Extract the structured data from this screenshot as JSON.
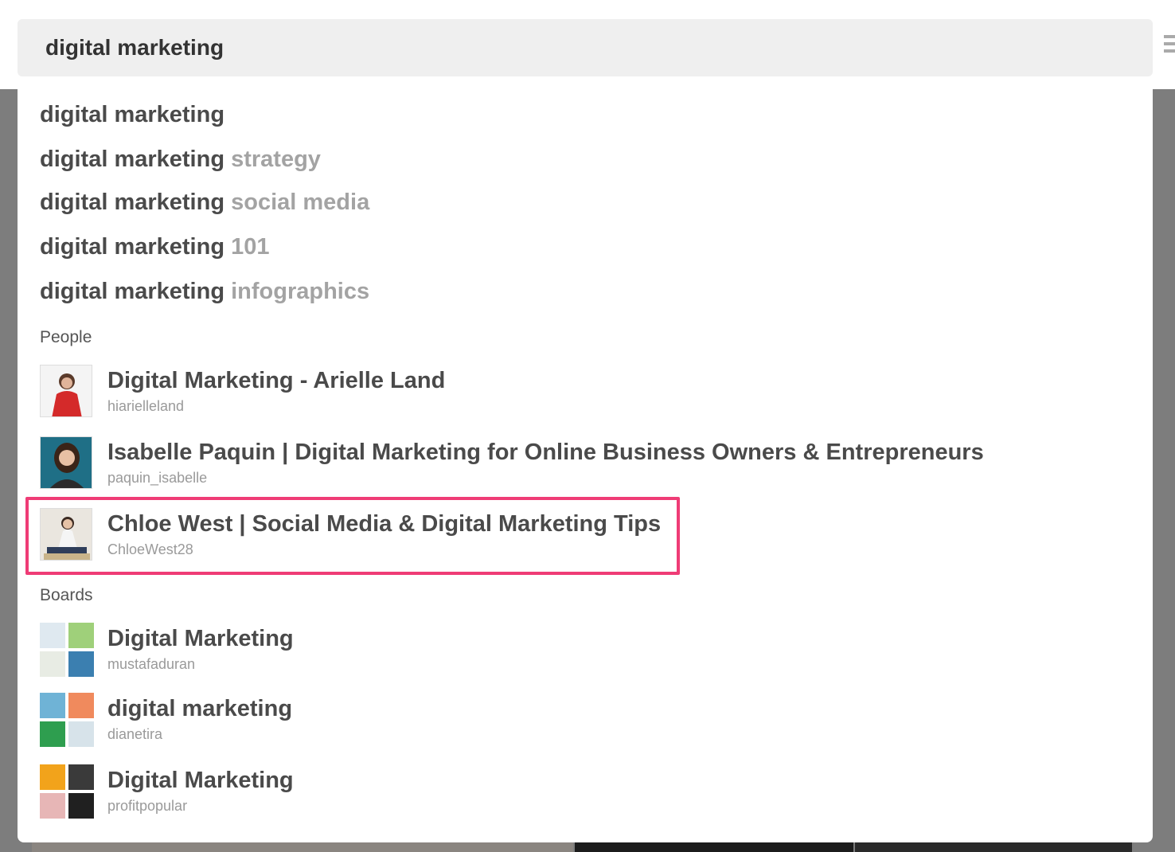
{
  "search": {
    "value": "digital marketing"
  },
  "suggestions": [
    {
      "query": "digital marketing",
      "suffix": ""
    },
    {
      "query": "digital marketing",
      "suffix": "strategy"
    },
    {
      "query": "digital marketing",
      "suffix": "social media"
    },
    {
      "query": "digital marketing",
      "suffix": "101"
    },
    {
      "query": "digital marketing",
      "suffix": "infographics"
    }
  ],
  "people": {
    "label": "People",
    "items": [
      {
        "name": "Digital Marketing - Arielle Land",
        "username": "hiarielleland"
      },
      {
        "name": "Isabelle Paquin | Digital Marketing for Online Business Owners & Entrepreneurs",
        "username": "paquin_isabelle"
      },
      {
        "name": "Chloe West | Social Media & Digital Marketing Tips",
        "username": "ChloeWest28"
      }
    ]
  },
  "boards": {
    "label": "Boards",
    "items": [
      {
        "name": "Digital Marketing",
        "owner": "mustafaduran"
      },
      {
        "name": "digital marketing",
        "owner": "dianetira"
      },
      {
        "name": "Digital Marketing",
        "owner": "profitpopular"
      }
    ]
  },
  "colors": {
    "highlight": "#ef3c76",
    "backdrop": "#7d7d7d"
  },
  "icons": {
    "menu": "hamburger-icon"
  }
}
